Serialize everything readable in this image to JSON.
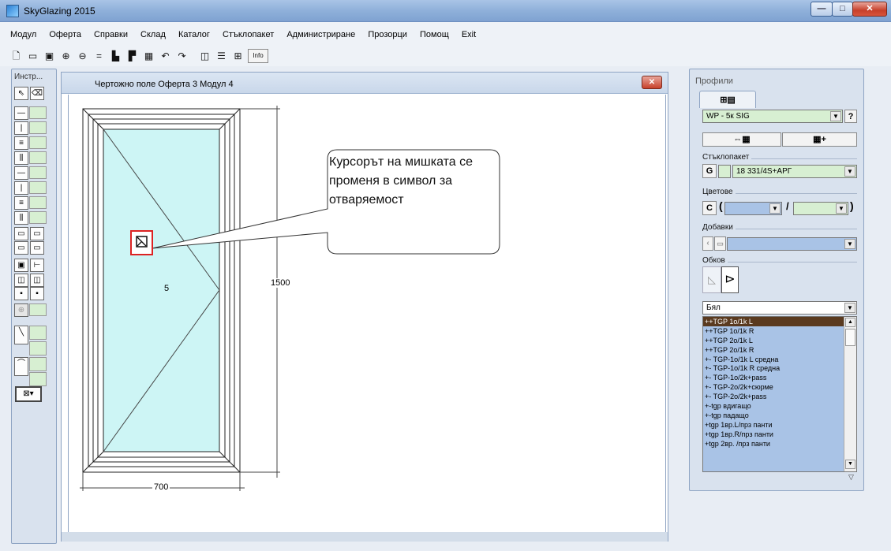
{
  "app": {
    "title": "SkyGlazing 2015",
    "min_label": "—",
    "max_label": "□",
    "close_label": "✕"
  },
  "menu": [
    "Модул",
    "Оферта",
    "Справки",
    "Склад",
    "Каталог",
    "Стъклопакет",
    "Администриране",
    "Прозорци",
    "Помощ",
    "Exit"
  ],
  "toolbar": {
    "info_label": "Info"
  },
  "tools": {
    "title": "Инстр..."
  },
  "drawing": {
    "title": "Чертожно поле   Оферта 3   Модул 4",
    "close_label": "✕",
    "sash_label": "5",
    "dim_height": "1500",
    "dim_width": "700",
    "callout_text": "Курсорът на мишката се променя в символ за отваряемост"
  },
  "panel": {
    "title": "Профили",
    "profile_value": "WP - 5к SIG",
    "help_label": "?",
    "glass_label": "Стъклопакет",
    "glass_btn": "G",
    "glass_value": "18 331/4S+АРГ",
    "colors_label": "Цветове",
    "colors_btn": "C",
    "open_paren": "(",
    "slash": "/",
    "close_paren": ")",
    "extras_label": "Добавки",
    "frame_label": "Обков",
    "frame_color": "Бял",
    "items": [
      "++TGP 1o/1k L",
      "++TGP 1o/1k R",
      "++TGP 2o/1k L",
      "++TGP 2o/1k R",
      "+- TGP-1o/1k L средна",
      "+- TGP-1o/1k R средна",
      "+- TGP-1o/2k+pass",
      "+- TGP-2o/2k+сюрме",
      "+- TGP-2o/2k+pass",
      "+-tgp вдигащо",
      "+-tgp падащо",
      "+tgp 1вр.L/прз панти",
      "+tgp 1вр.R/прз панти",
      "+tgp 2вр.  /прз панти"
    ]
  }
}
